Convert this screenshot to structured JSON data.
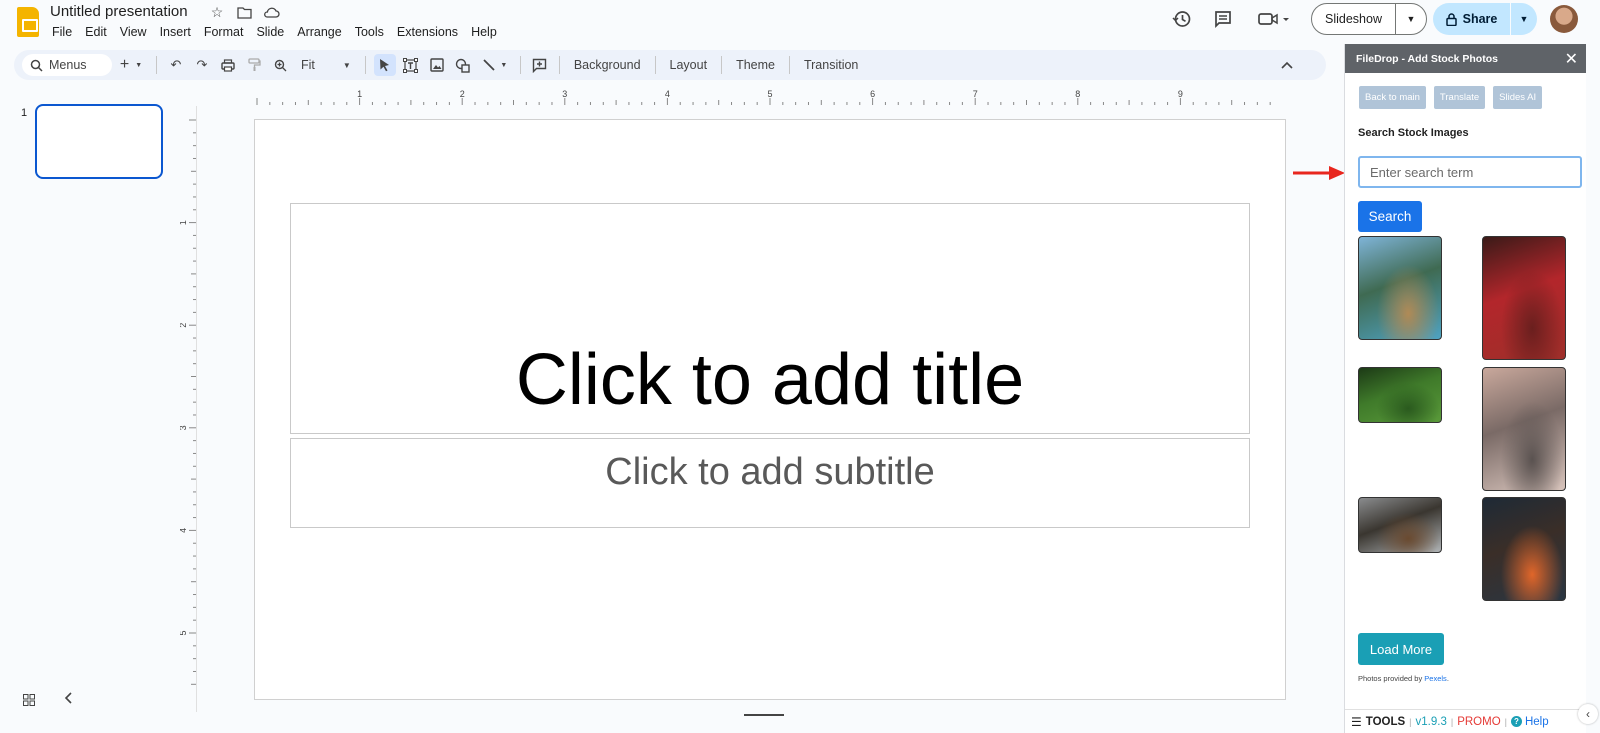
{
  "app": {
    "title": "Untitled presentation",
    "menus": [
      "File",
      "Edit",
      "View",
      "Insert",
      "Format",
      "Slide",
      "Arrange",
      "Tools",
      "Extensions",
      "Help"
    ],
    "slideshow_label": "Slideshow",
    "share_label": "Share"
  },
  "toolbar": {
    "search_placeholder": "Menus",
    "zoom_value": "Fit",
    "background_label": "Background",
    "layout_label": "Layout",
    "theme_label": "Theme",
    "transition_label": "Transition"
  },
  "filmstrip": {
    "slides": [
      {
        "number": "1"
      }
    ]
  },
  "rulers": {
    "horizontal_ticks": [
      "1",
      "2",
      "3",
      "4",
      "5",
      "6",
      "7",
      "8",
      "9"
    ],
    "vertical_ticks": [
      "1",
      "2",
      "3",
      "4",
      "5"
    ]
  },
  "slide": {
    "title_placeholder": "Click to add title",
    "subtitle_placeholder": "Click to add subtitle"
  },
  "sidebar": {
    "header": "FileDrop - Add Stock Photos",
    "nav": [
      "Back to main",
      "Translate",
      "Slides AI"
    ],
    "heading": "Search Stock Images",
    "search_placeholder": "Enter search term",
    "search_value": "",
    "search_button": "Search",
    "photos": [
      {
        "subject": "mountain river canyon",
        "colors": [
          "#7fb4d8",
          "#3f6a52",
          "#b08a56",
          "#4fa3c2"
        ]
      },
      {
        "subject": "red autumn forest",
        "colors": [
          "#3a1a18",
          "#b3262b",
          "#6a1f1e",
          "#9e2f2a"
        ]
      },
      {
        "subject": "green forest",
        "colors": [
          "#1c3a16",
          "#3f7a2a",
          "#2a5a1e",
          "#5a9a3a"
        ]
      },
      {
        "subject": "misty mountain peak",
        "colors": [
          "#c9a89c",
          "#7a6a66",
          "#5a5250",
          "#d8c4bc"
        ]
      },
      {
        "subject": "cloudy hills",
        "colors": [
          "#8a8c8e",
          "#3a3630",
          "#6a4a30",
          "#b0b4b6"
        ]
      },
      {
        "subject": "night road light trails",
        "colors": [
          "#1e2a36",
          "#3a2e28",
          "#e0662a",
          "#2a3642"
        ]
      }
    ],
    "load_more": "Load More",
    "credit_prefix": "Photos provided by ",
    "credit_link": "Pexels",
    "credit_suffix": ".",
    "footer": {
      "tools": "TOOLS",
      "version": "v1.9.3",
      "promo": "PROMO",
      "help": "Help"
    }
  }
}
